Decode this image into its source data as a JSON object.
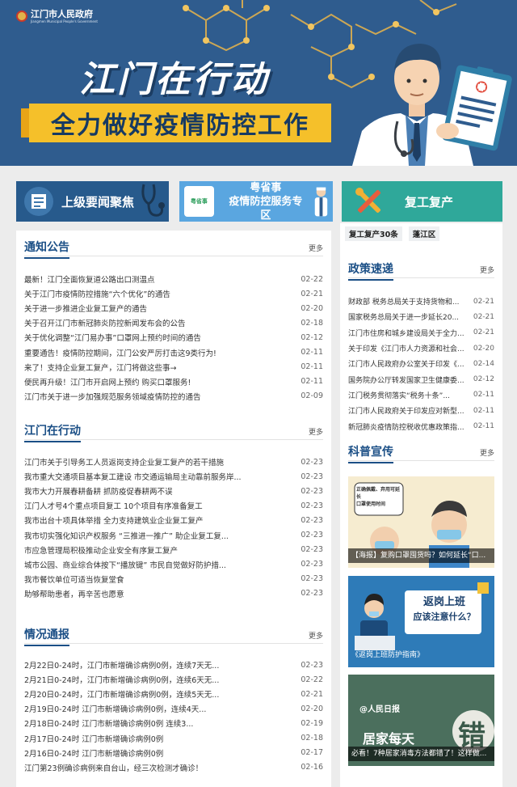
{
  "header": {
    "logo_text": "江门市人民政府",
    "logo_subtext": "Jiangmen Municipal People's Government",
    "banner_title": "江门在行动",
    "banner_subtitle": "全力做好疫情防控工作"
  },
  "tiles": [
    {
      "label": "上级要闻聚焦",
      "icon": "newspaper-stethoscope-icon"
    },
    {
      "label_line1": "粤省事",
      "label_line2": "疫情防控服务专区",
      "badge": "粤省事",
      "icon": "medical-staff-icon"
    },
    {
      "label": "复工复产",
      "icon": "tools-icon"
    }
  ],
  "notices": {
    "title": "通知公告",
    "more": "更多",
    "items": [
      {
        "title": "最新！江门全面恢复道公路出口测温点",
        "date": "02-22"
      },
      {
        "title": "关于江门市疫情防控措施“六个优化”的通告",
        "date": "02-21"
      },
      {
        "title": "关于进一步推进企业复工复产的通告",
        "date": "02-20"
      },
      {
        "title": "关于召开江门市新冠肺炎防控新闻发布会的公告",
        "date": "02-18"
      },
      {
        "title": "关于优化调整“江门易办事”口罩网上预约时间的通告",
        "date": "02-12"
      },
      {
        "title": "重要通告！疫情防控期间，江门公安严厉打击这9类行为!",
        "date": "02-11"
      },
      {
        "title": "来了！支持企业复工复产，江门将做这些事→",
        "date": "02-11"
      },
      {
        "title": "便民再升级！江门市开启网上预约 购买口罩服务!",
        "date": "02-11"
      },
      {
        "title": "江门市关于进一步加强规范服务领域疫情防控的通告",
        "date": "02-09"
      }
    ]
  },
  "actions": {
    "title": "江门在行动",
    "more": "更多",
    "items": [
      {
        "title": "江门市关于引导务工人员返岗支持企业复工复产的若干措施",
        "date": "02-23"
      },
      {
        "title": "我市重大交通项目基本复工建设 市交通运输局主动靠前服务岸...",
        "date": "02-23"
      },
      {
        "title": "我市大力开展春耕备耕 抓防疫促春耕两不误",
        "date": "02-23"
      },
      {
        "title": "江门人才号4个重点项目复工 10个项目有序准备复工",
        "date": "02-23"
      },
      {
        "title": "我市出台十项具体举措 全力支持建筑业企业复工复产",
        "date": "02-23"
      },
      {
        "title": "我市切实强化知识产权服务 “三推进一推广” 助企业复工复...",
        "date": "02-23"
      },
      {
        "title": "市应急管理局积极推动企业安全有序复工复产",
        "date": "02-23"
      },
      {
        "title": "城市公园、商业综合体按下“播放键” 市民自觉做好防护措...",
        "date": "02-23"
      },
      {
        "title": "我市餐饮单位可适当恢复堂食",
        "date": "02-23"
      },
      {
        "title": "助够帮助患者，再辛苦也愿意",
        "date": "02-23"
      }
    ]
  },
  "situation": {
    "title": "情况通报",
    "more": "更多",
    "items": [
      {
        "title": "2月22日0-24时，江门市新增确诊病例0例，连续7天无...",
        "date": "02-23"
      },
      {
        "title": "2月21日0-24时，江门市新增确诊病例0例，连续6天无...",
        "date": "02-22"
      },
      {
        "title": "2月20日0-24时，江门市新增确诊病例0例，连续5天无...",
        "date": "02-21"
      },
      {
        "title": "2月19日0-24时 江门市新增确诊病例0例，连续4天...",
        "date": "02-20"
      },
      {
        "title": "2月18日0-24时 江门市新增确诊病例0例 连续3...",
        "date": "02-19"
      },
      {
        "title": "2月17日0-24时 江门市新增确诊病例0例",
        "date": "02-18"
      },
      {
        "title": "2月16日0-24时 江门市新增确诊病例0例",
        "date": "02-17"
      },
      {
        "title": "江门第23例确诊病例来自台山，经三次检测才确诊！",
        "date": "02-16"
      }
    ]
  },
  "work_tags": [
    "复工复产30条",
    "蓬江区"
  ],
  "policy": {
    "title": "政策速递",
    "more": "更多",
    "items": [
      {
        "title": "财政部 税务总局关于支持货物和...",
        "date": "02-21"
      },
      {
        "title": "国家税务总局关于进一步延长20...",
        "date": "02-21"
      },
      {
        "title": "江门市住房和城乡建设局关于全力...",
        "date": "02-21"
      },
      {
        "title": "关于印发《江门市人力资源和社会...",
        "date": "02-20"
      },
      {
        "title": "江门市人民政府办公室关于印发《...",
        "date": "02-14"
      },
      {
        "title": "国务院办公厅转发国家卫生健康委...",
        "date": "02-12"
      },
      {
        "title": "江门税务贯彻落实“税务十条”...",
        "date": "02-11"
      },
      {
        "title": "江门市人民政府关于印发应对新型...",
        "date": "02-11"
      },
      {
        "title": "新冠肺炎疫情防控税收优惠政策指...",
        "date": "02-11"
      }
    ]
  },
  "science": {
    "title": "科普宣传",
    "more": "更多",
    "promos": [
      {
        "caption": "【海报】复购口罩囤货吗？如何延长“口...",
        "bubble1": "正确佩戴、弃用可延长",
        "bubble2": "口罩使用时间"
      },
      {
        "caption": "《返岗上班防护指南》",
        "headline1": "返岗上班",
        "headline2": "应该注意什么？"
      },
      {
        "caption": "必看！7种居家消毒方法都错了！这样做...",
        "brand": "@人民日报",
        "overlay": "居家每天",
        "glyph": "错"
      }
    ]
  },
  "colors": {
    "banner": "#2f5c8e",
    "accent_yellow": "#f5c02a",
    "section_title": "#1b4f86",
    "tile_teal": "#2fa89a"
  }
}
